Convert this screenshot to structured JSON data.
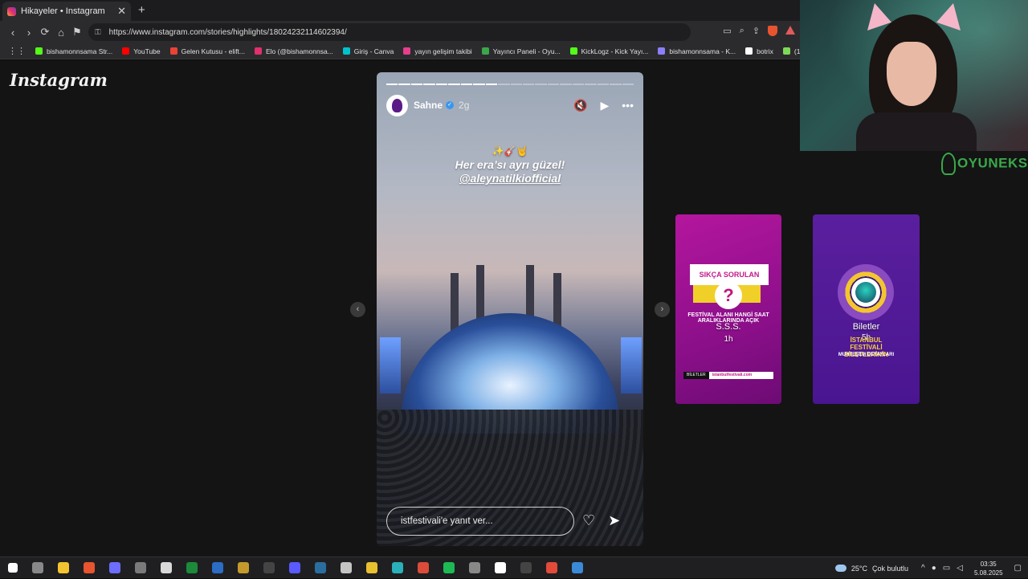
{
  "browser": {
    "tab_title": "Hikayeler • Instagram",
    "tab_close": "✕",
    "new_tab": "+",
    "url": "https://www.instagram.com/stories/highlights/18024232114602394/",
    "nav": {
      "back": "‹",
      "forward": "›",
      "reload": "⟳",
      "home": "⌂",
      "bookmark": "⚑"
    },
    "bookmarks": [
      {
        "label": "bishamonnsama Str...",
        "color": "#53fc18"
      },
      {
        "label": "YouTube",
        "color": "#ff0000"
      },
      {
        "label": "Gelen Kutusu - elift...",
        "color": "#ea4335"
      },
      {
        "label": "Elo (@bishamonnsa...",
        "color": "#e1306c"
      },
      {
        "label": "Giriş - Canva",
        "color": "#00c4cc"
      },
      {
        "label": "yayın gelişim takibi",
        "color": "#e83e8c"
      },
      {
        "label": "Yayıncı Paneli - Oyu...",
        "color": "#3aa84a"
      },
      {
        "label": "KickLogz - Kick Yayı...",
        "color": "#53fc18"
      },
      {
        "label": "bishamonnsama - K...",
        "color": "#8a7fff"
      },
      {
        "label": "botrix",
        "color": "#ffffff"
      },
      {
        "label": "(15) Dashboard...",
        "color": "#7ed957"
      }
    ]
  },
  "instagram": {
    "logo": "Instagram",
    "story": {
      "username": "Sahne",
      "verified_mark": "✓",
      "age": "2g",
      "caption_emoji": "✨🎸🤘",
      "caption_line1": "Her era’sı ayrı güzel!",
      "caption_mention": "@aleynatilkiofficial",
      "reply_placeholder": "istfestivali'e yanıt ver...",
      "mute_icon": "🔇",
      "play_icon": "▶",
      "more_icon": "•••",
      "like_icon": "♡",
      "send_icon": "➤",
      "progress_total": 20,
      "progress_done": 9
    },
    "prev_arrow": "‹",
    "next_arrow": "›",
    "previews": [
      {
        "banner": "SIKÇA SORULAN",
        "text": "FESTİVAL ALANI HANGİ SAAT ARALIKLARINDA AÇIK",
        "label": "S.S.S.",
        "age": "1h",
        "foot_left": "BİLETLER",
        "foot_right": "istanbulfestivali.com"
      },
      {
        "text": "İSTANBUL FESTİVALİ BİLETLERİNİN",
        "sub": "MUHTEŞEM DETAYLARI",
        "label": "Biletler",
        "age": "5h"
      }
    ]
  },
  "overlay": {
    "brand": "OYUNEKS"
  },
  "taskbar": {
    "weather_temp": "25°C",
    "weather_text": "Çok bulutlu",
    "time": "03:35",
    "date": "5.08.2025"
  }
}
